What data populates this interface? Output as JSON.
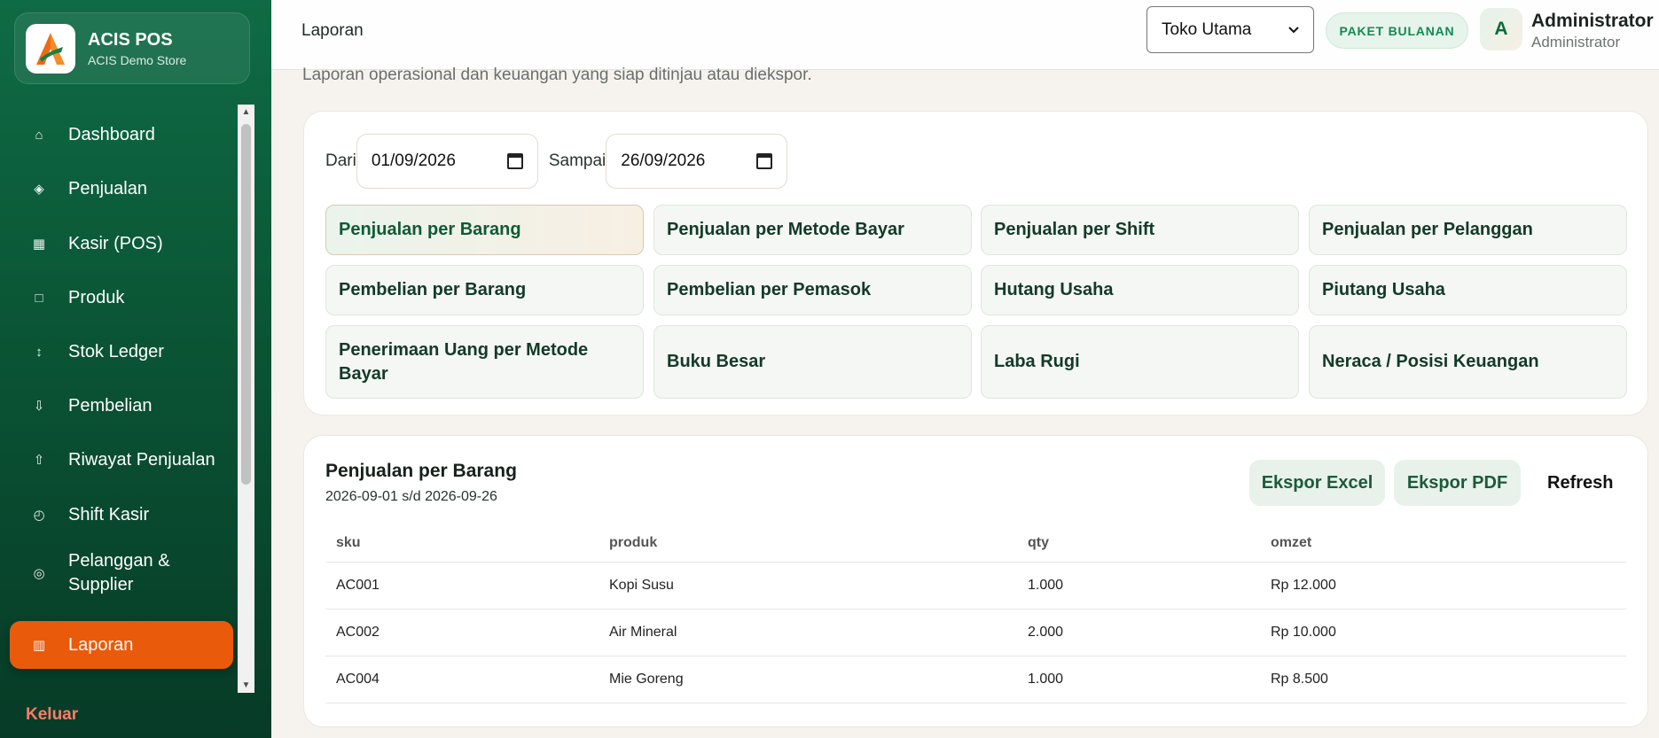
{
  "brand": {
    "name": "ACIS POS",
    "store": "ACIS Demo Store"
  },
  "sidebar": {
    "items": [
      {
        "icon": "home-icon",
        "glyph": "⌂",
        "label": "Dashboard"
      },
      {
        "icon": "sales-icon",
        "glyph": "◈",
        "label": "Penjualan"
      },
      {
        "icon": "cashier-grid-icon",
        "glyph": "▦",
        "label": "Kasir (POS)"
      },
      {
        "icon": "product-box-icon",
        "glyph": "□",
        "label": "Produk"
      },
      {
        "icon": "up-down-arrow-icon",
        "glyph": "↕",
        "label": "Stok Ledger"
      },
      {
        "icon": "download-arrow-icon",
        "glyph": "⇩",
        "label": "Pembelian"
      },
      {
        "icon": "upload-arrow-icon",
        "glyph": "⇧",
        "label": "Riwayat Penjualan"
      },
      {
        "icon": "clock-icon",
        "glyph": "◴",
        "label": "Shift Kasir"
      },
      {
        "icon": "target-icon",
        "glyph": "◎",
        "label": "Pelanggan & Supplier"
      },
      {
        "icon": "report-bars-icon",
        "glyph": "▥",
        "label": "Laporan"
      }
    ],
    "logout": "Keluar"
  },
  "topbar": {
    "breadcrumb": "Laporan",
    "store_select": "Toko Utama",
    "plan_badge": "PAKET BULANAN",
    "avatar_initial": "A",
    "user_name": "Administrator",
    "user_role": "Administrator"
  },
  "page": {
    "subtitle": "Laporan operasional dan keuangan yang siap ditinjau atau diekspor."
  },
  "filters": {
    "from_label": "Dari",
    "from_value": "01/09/2026",
    "to_label": "Sampai",
    "to_value": "26/09/2026",
    "reports": [
      "Penjualan per Barang",
      "Penjualan per Metode Bayar",
      "Penjualan per Shift",
      "Penjualan per Pelanggan",
      "Pembelian per Barang",
      "Pembelian per Pemasok",
      "Hutang Usaha",
      "Piutang Usaha",
      "Penerimaan Uang per Metode Bayar",
      "Buku Besar",
      "Laba Rugi",
      "Neraca / Posisi Keuangan"
    ]
  },
  "result": {
    "title": "Penjualan per Barang",
    "range": "2026-09-01 s/d 2026-09-26",
    "export_excel": "Ekspor Excel",
    "export_pdf": "Ekspor PDF",
    "refresh": "Refresh",
    "columns": [
      "sku",
      "produk",
      "qty",
      "omzet"
    ],
    "rows": [
      [
        "AC001",
        "Kopi Susu",
        "1.000",
        "Rp 12.000"
      ],
      [
        "AC002",
        "Air Mineral",
        "2.000",
        "Rp 10.000"
      ],
      [
        "AC004",
        "Mie Goreng",
        "1.000",
        "Rp 8.500"
      ]
    ]
  },
  "colors": {
    "sidebar_green": "#0a5535",
    "active_orange": "#ea5a0b",
    "accent_green": "#138a4f"
  }
}
